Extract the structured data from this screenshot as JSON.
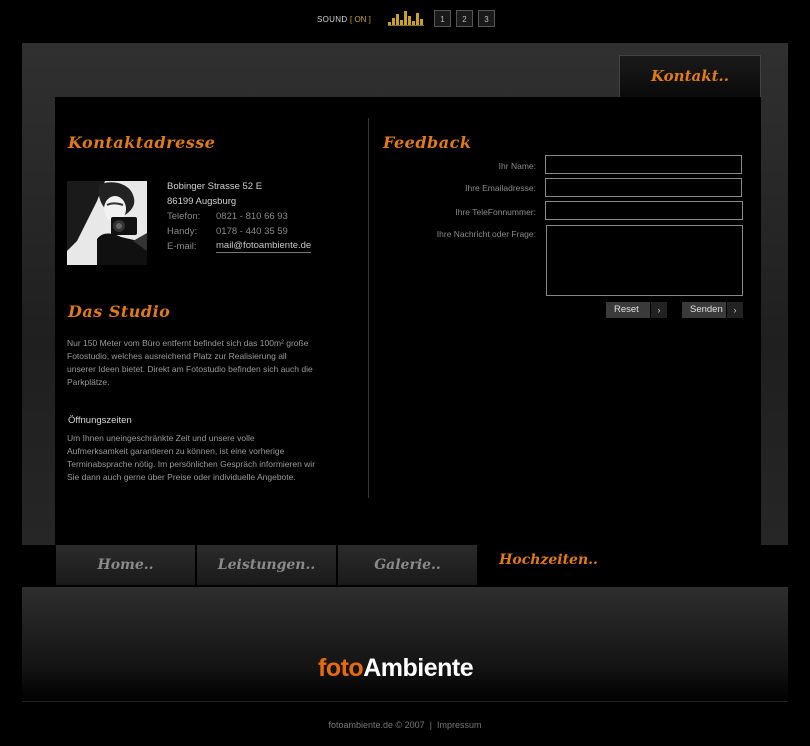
{
  "sound": {
    "label": "SOUND",
    "state": "[ ON ]"
  },
  "pages": [
    "1",
    "2",
    "3"
  ],
  "header": {
    "tab": "Kontakt.."
  },
  "kontakt": {
    "heading": "Kontaktadresse",
    "street": "Bobinger Strasse 52 E",
    "city": "86199 Augsburg",
    "phone_label": "Telefon:",
    "phone": "0821 - 810 66 93",
    "mobile_label": "Handy:",
    "mobile": "0178 - 440 35 59",
    "email_label": "E-mail:",
    "email": "mail@fotoambiente.de"
  },
  "studio": {
    "heading": "Das Studio",
    "text": "Nur 150 Meter vom Büro entfernt befindet sich das 100m² große Fotostudio, welches ausreichend Platz zur Realisierung all unserer Ideen bietet. Direkt am Fotostudio befinden sich auch die Parkplätze.",
    "hours_title": "Öffnungszeiten",
    "hours_text": "Um Ihnen uneingeschränkte Zeit und unsere volle Aufmerksamkeit garantieren zu können, ist eine vorherige Terminabsprache nötig. Im persönlichen Gespräch informieren wir Sie dann auch gerne über Preise oder individuelle Angebote."
  },
  "feedback": {
    "heading": "Feedback",
    "name_label": "Ihr Name:",
    "email_label": "Ihre Emailadresse:",
    "phone_label": "Ihre TeleFonnummer:",
    "message_label": "Ihre Nachricht oder Frage:",
    "reset": "Reset",
    "send": "Senden",
    "arrow": "›"
  },
  "nav": [
    "Home..",
    "Leistungen..",
    "Galerie..",
    "Hochzeiten.."
  ],
  "logo": {
    "part1": "foto",
    "part2": "Ambiente"
  },
  "footer": {
    "copyright": "fotoambiente.de © 2007",
    "sep": "|",
    "impressum": "Impressum"
  },
  "colors": {
    "accent": "#e07a1a",
    "background": "#000000"
  }
}
